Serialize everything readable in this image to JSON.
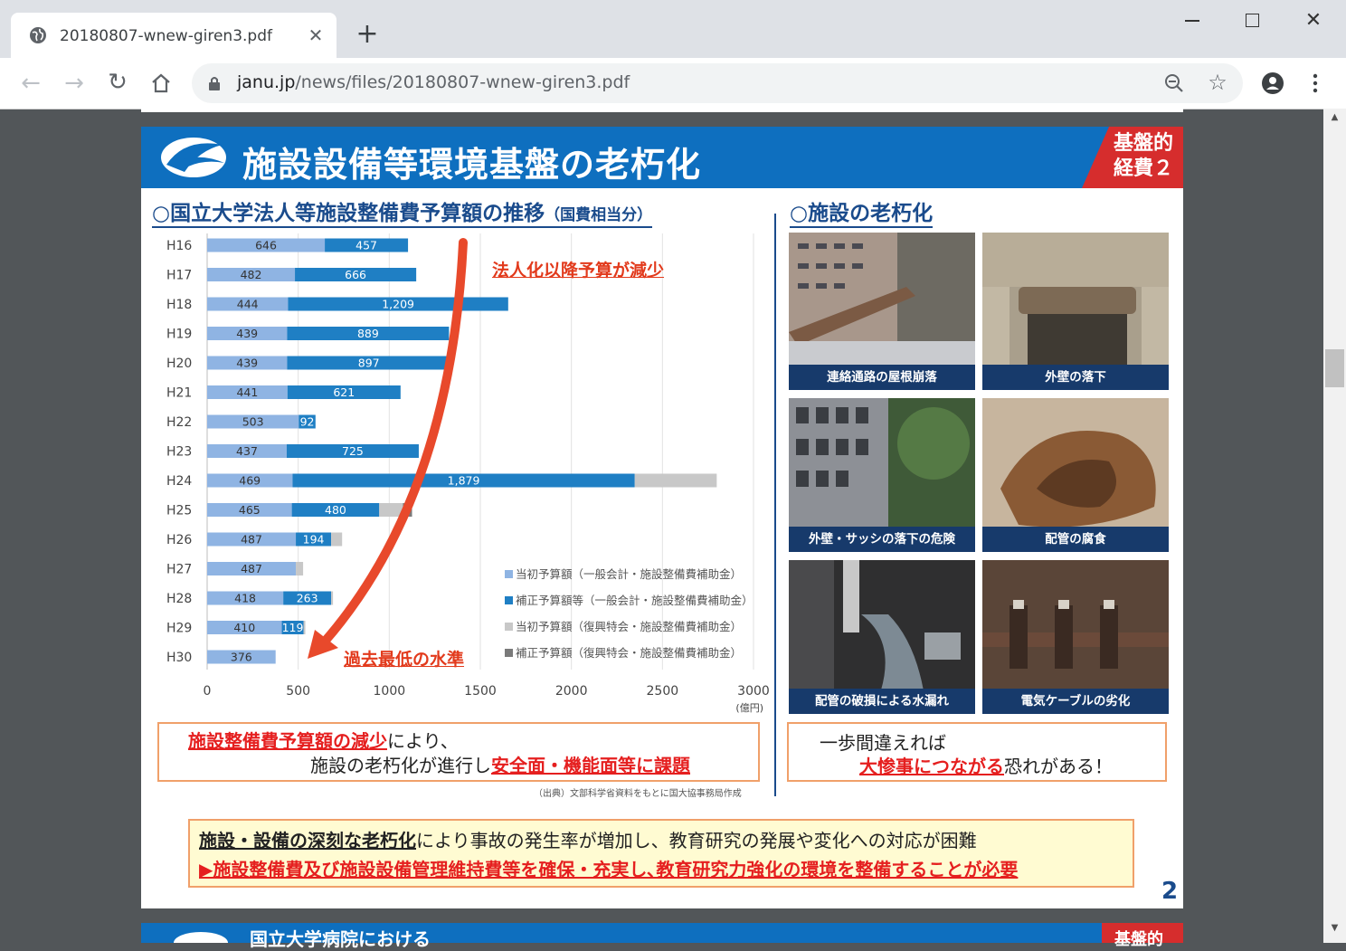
{
  "browser": {
    "tab_title": "20180807-wnew-giren3.pdf",
    "url_host": "janu.jp",
    "url_path": "/news/files/20180807-wnew-giren3.pdf"
  },
  "slide": {
    "title": "施設設備等環境基盤の老朽化",
    "badge_line1": "基盤的",
    "badge_line2": "経費２",
    "left_title": "○国立大学法人等施設整備費予算額の推移",
    "left_title_paren": "（国費相当分）",
    "right_title": "○施設の老朽化",
    "callout_top": "法人化以降予算が減少",
    "callout_bottom": "過去最低の水準",
    "box_left": {
      "red1": "施設整備費予算額の減少",
      "t1": "により、",
      "t2": "施設の老朽化が進行し",
      "red2": "安全面・機能面等に課題"
    },
    "box_right": {
      "t1": "一歩間違えれば",
      "red": "大惨事につながる",
      "t2": "恐れがある！"
    },
    "source": "（出典）文部科学省資料をもとに国大協事務局作成",
    "bottom": {
      "bold": "施設・設備の深刻な老朽化",
      "rest": "により事故の発生率が増加し、教育研究の発展や変化への対応が困難",
      "line2": "▶施設整備費及び施設設備管理維持費等を確保・充実し､教育研究力強化の環境を整備することが必要"
    },
    "page_number": "2",
    "next_slide_title": "国立大学病院における",
    "next_badge": "基盤的",
    "photos": [
      {
        "caption": "連絡通路の屋根崩落"
      },
      {
        "caption": "外壁の落下"
      },
      {
        "caption": "外壁・サッシの落下の危険"
      },
      {
        "caption": "配管の腐食"
      },
      {
        "caption": "配管の破損による水漏れ"
      },
      {
        "caption": "電気ケーブルの劣化"
      }
    ]
  },
  "chart_data": {
    "type": "bar",
    "orientation": "horizontal",
    "stacked": true,
    "categories": [
      "H16",
      "H17",
      "H18",
      "H19",
      "H20",
      "H21",
      "H22",
      "H23",
      "H24",
      "H25",
      "H26",
      "H27",
      "H28",
      "H29",
      "H30"
    ],
    "series": [
      {
        "name": "当初予算額（一般会計・施設整備費補助金）",
        "color": "#8fb4e3",
        "values": [
          646,
          482,
          444,
          439,
          439,
          441,
          503,
          437,
          469,
          465,
          487,
          487,
          418,
          410,
          376
        ],
        "labels": [
          "646",
          "482",
          "444",
          "439",
          "439",
          "441",
          "503",
          "437",
          "469",
          "465",
          "487",
          "487",
          "418",
          "410",
          "376"
        ]
      },
      {
        "name": "補正予算額等（一般会計・施設整備費補助金）",
        "color": "#1f7fc4",
        "values": [
          457,
          666,
          1209,
          889,
          897,
          621,
          92,
          725,
          1879,
          480,
          194,
          0,
          263,
          119,
          0
        ],
        "labels": [
          "457",
          "666",
          "1,209",
          "889",
          "897",
          "621",
          "92",
          "725",
          "1,879",
          "480",
          "194",
          "",
          "263",
          "119",
          ""
        ]
      },
      {
        "name": "当初予算額（復興特会・施設整備費補助金）",
        "color": "#c8c8c8",
        "values": [
          0,
          0,
          0,
          0,
          0,
          0,
          0,
          0,
          450,
          130,
          60,
          40,
          10,
          10,
          0
        ],
        "labels": [
          "",
          "",
          "",
          "",
          "",
          "",
          "",
          "",
          "",
          "",
          "",
          "",
          "",
          "",
          ""
        ]
      },
      {
        "name": "補正予算額（復興特会・施設整備費補助金）",
        "color": "#7a7a7a",
        "values": [
          0,
          0,
          0,
          0,
          0,
          0,
          0,
          0,
          0,
          50,
          0,
          0,
          0,
          0,
          0
        ],
        "labels": [
          "",
          "",
          "",
          "",
          "",
          "",
          "",
          "",
          "",
          "",
          "",
          "",
          "",
          "",
          ""
        ]
      }
    ],
    "xlim": [
      0,
      3000
    ],
    "xticks": [
      "0",
      "500",
      "1000",
      "1500",
      "2000",
      "2500",
      "3000"
    ],
    "xunit": "(億円)",
    "grid": true,
    "legend_position": "bottom-right"
  }
}
